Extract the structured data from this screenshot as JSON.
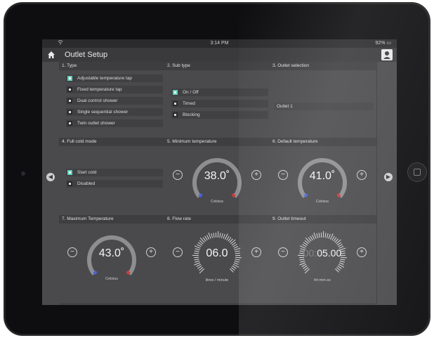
{
  "status": {
    "time": "3:14 PM",
    "battery": "92% ▭",
    "wifi": "wifi"
  },
  "header": {
    "title": "Outlet Setup"
  },
  "panels": {
    "type": {
      "header": "1. Type",
      "options": [
        {
          "label": "Adjustable temperature tap",
          "selected": true
        },
        {
          "label": "Fixed temperature tap",
          "selected": false
        },
        {
          "label": "Dual control shower",
          "selected": false
        },
        {
          "label": "Single sequential shower",
          "selected": false
        },
        {
          "label": "Twin outlet shower",
          "selected": false
        }
      ]
    },
    "subtype": {
      "header": "2. Sub type",
      "options": [
        {
          "label": "On / Off",
          "selected": true
        },
        {
          "label": "Timed",
          "selected": false
        },
        {
          "label": "Blocking",
          "selected": false
        }
      ]
    },
    "outlet_selection": {
      "header": "3. Outlet selection",
      "items": [
        "Outlet 1"
      ]
    },
    "full_cold": {
      "header": "4. Full cold mode",
      "options": [
        {
          "label": "Start cold",
          "selected": true
        },
        {
          "label": "Disabled",
          "selected": false
        }
      ]
    },
    "min_temp": {
      "header": "5. Minimum temperature",
      "value": "38.0˚",
      "unit": "Celsius"
    },
    "default_temp": {
      "header": "6. Default temperature",
      "value": "41.0˚",
      "unit": "Celsius"
    },
    "max_temp": {
      "header": "7. Maximum Temperature",
      "value": "43.0˚",
      "unit": "Celsius"
    },
    "flow": {
      "header": "8. Flow rate",
      "value": "06.0",
      "unit": "litres / minute"
    },
    "timeout": {
      "header": "9. Outlet timeout",
      "value_dim": "00:",
      "value": "05.00",
      "unit": "hh:mm.ss"
    }
  },
  "controls": {
    "minus": "−",
    "plus": "+",
    "prev": "◀",
    "next": "▶"
  },
  "colors": {
    "accent": "#5fd0b8",
    "low_marker": "#4a63d8",
    "high_marker": "#d03a3a"
  }
}
